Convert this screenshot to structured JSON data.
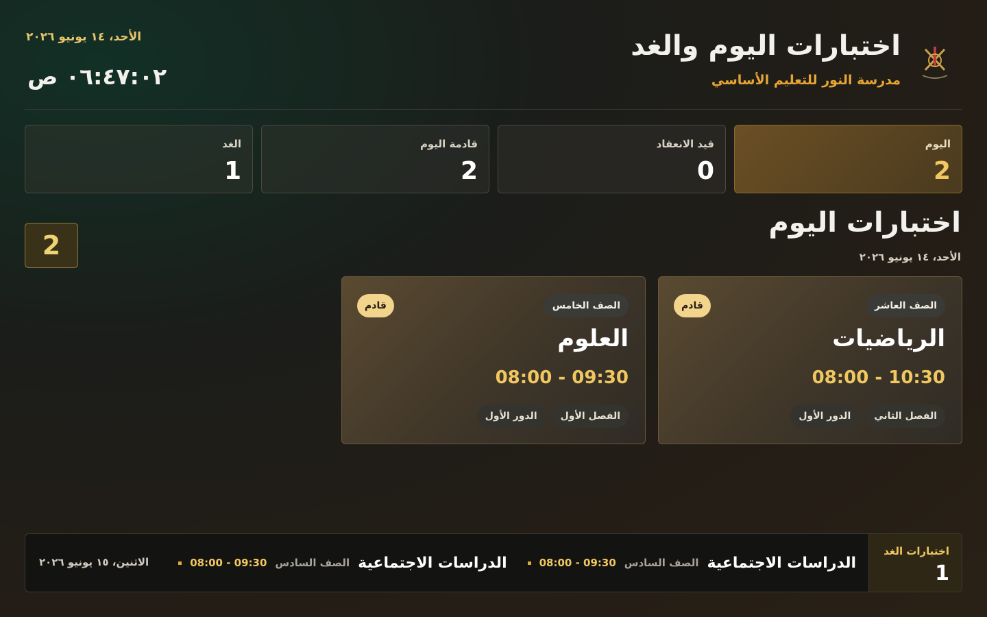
{
  "header": {
    "title": "اختبارات اليوم والغد",
    "school": "مدرسة النور للتعليم الأساسي",
    "date": "الأحد، ١٤ يونيو ٢٠٢٦",
    "clock": "٠٦:٤٧:٠٢ ص",
    "logo_icon": "oman-emblem-icon"
  },
  "stats": [
    {
      "label": "اليوم",
      "value": "2"
    },
    {
      "label": "قيد الانعقاد",
      "value": "0"
    },
    {
      "label": "قادمة اليوم",
      "value": "2"
    },
    {
      "label": "الغد",
      "value": "1"
    }
  ],
  "today": {
    "title": "اختبارات اليوم",
    "date": "الأحد، ١٤ يونيو ٢٠٢٦",
    "count": "2",
    "exams": [
      {
        "grade": "الصف العاشر",
        "status": "قادم",
        "subject": "الرياضيات",
        "time": "08:00 - 10:30",
        "semester": "الفصل الثاني",
        "round": "الدور الأول"
      },
      {
        "grade": "الصف الخامس",
        "status": "قادم",
        "subject": "العلوم",
        "time": "08:00 - 09:30",
        "semester": "الفصل الأول",
        "round": "الدور الأول"
      }
    ]
  },
  "tomorrow": {
    "label": "اختبارات الغد",
    "count": "1",
    "date": "الاثنين، ١٥ يونيو ٢٠٢٦",
    "items": [
      {
        "subject": "الدراسات الاجتماعية",
        "grade": "الصف السادس",
        "time": "08:00 - 09:30"
      },
      {
        "subject": "الدراسات الاجتماعية",
        "grade": "الصف السادس",
        "time": "08:00 - 09:30"
      }
    ]
  },
  "colors": {
    "accent": "#f0c760",
    "brand": "#e7a534"
  }
}
